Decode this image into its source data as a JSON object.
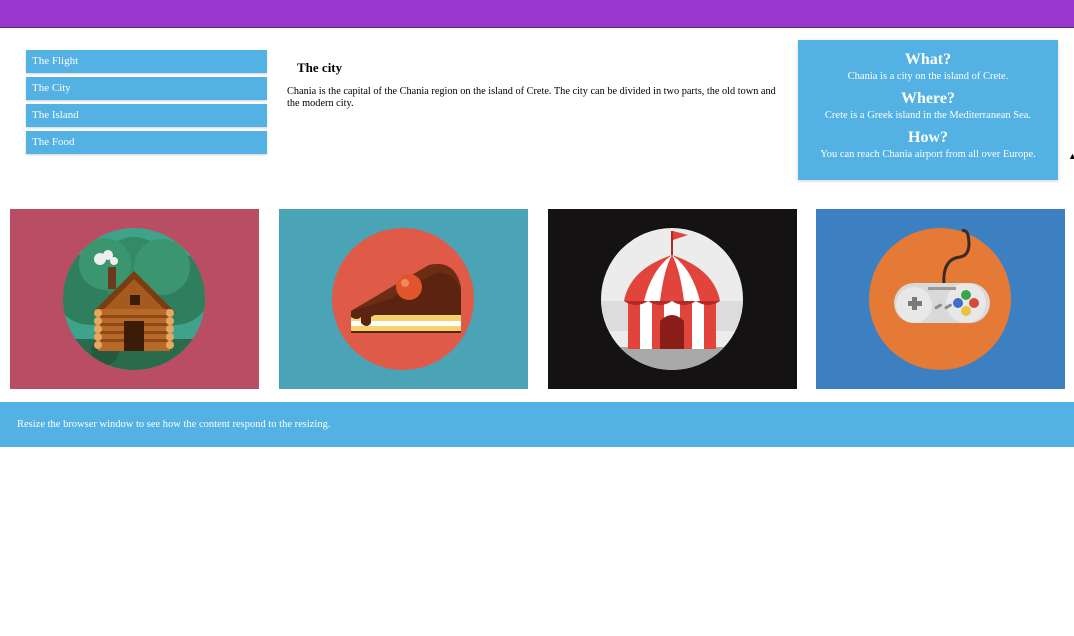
{
  "colors": {
    "header_bar": "#9a37cf",
    "accent_blue": "#53b1e3",
    "tile_cabin_bg": "#b94d64",
    "tile_cake_bg": "#4aa4b6",
    "tile_circus_bg": "#141212",
    "tile_gamepad_bg": "#3d80c2"
  },
  "menu": {
    "items": [
      {
        "label": "The Flight"
      },
      {
        "label": "The City"
      },
      {
        "label": "The Island"
      },
      {
        "label": "The Food"
      }
    ]
  },
  "main": {
    "title": "The city",
    "body": "Chania is the capital of the Chania region on the island of Crete. The city can be divided in two parts, the old town and the modern city."
  },
  "aside": {
    "what_heading": "What?",
    "what_text": "Chania is a city on the island of Crete.",
    "where_heading": "Where?",
    "where_text": "Crete is a Greek island in the Mediterranean Sea.",
    "how_heading": "How?",
    "how_text": "You can reach Chania airport from all over Europe."
  },
  "gallery": {
    "images": [
      {
        "icon": "log-cabin-icon"
      },
      {
        "icon": "cake-slice-icon"
      },
      {
        "icon": "circus-tent-icon"
      },
      {
        "icon": "gamepad-icon"
      }
    ]
  },
  "footer": {
    "text": "Resize the browser window to see how the content respond to the resizing."
  }
}
